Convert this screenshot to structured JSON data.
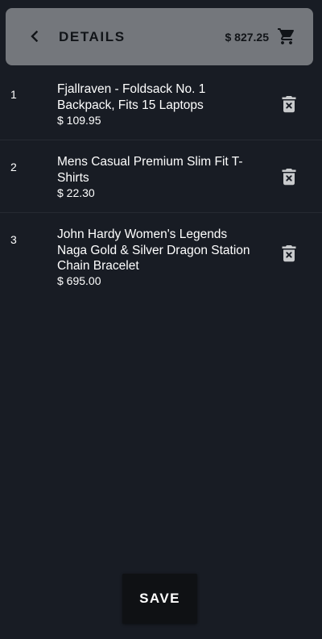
{
  "header": {
    "title": "DETAILS",
    "total": "$ 827.25",
    "back_icon": "chevron-left-icon",
    "cart_icon": "shopping-cart-icon"
  },
  "items": [
    {
      "index": "1",
      "name": "Fjallraven - Foldsack No. 1 Backpack, Fits 15 Laptops",
      "price": "$ 109.95"
    },
    {
      "index": "2",
      "name": "Mens Casual Premium Slim Fit T-Shirts",
      "price": "$ 22.30"
    },
    {
      "index": "3",
      "name": "John Hardy Women's Legends Naga Gold & Silver Dragon Station Chain Bracelet",
      "price": "$ 695.00"
    }
  ],
  "delete_icon": "delete-forever-icon",
  "save_label": "SAVE",
  "colors": {
    "background": "#181c24",
    "header_background": "#74777c",
    "header_text": "#111418",
    "text": "#ffffff",
    "icon_gray": "#c8cacc",
    "button_background": "#0f1114"
  }
}
